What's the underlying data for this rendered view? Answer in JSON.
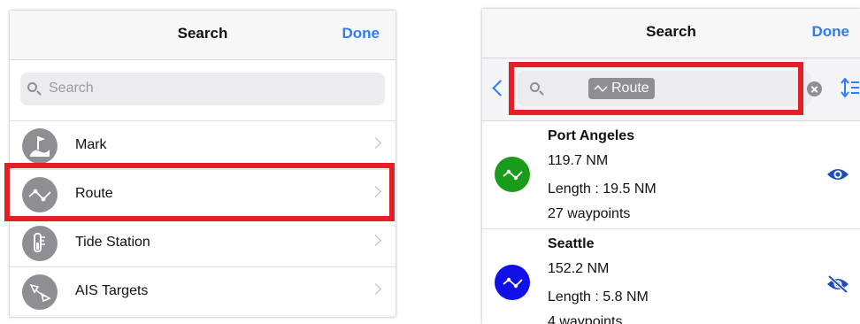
{
  "left_screen": {
    "title": "Search",
    "done_label": "Done",
    "search_placeholder": "Search",
    "categories": [
      {
        "label": "Mark",
        "icon": "mark-flag-icon"
      },
      {
        "label": "Route",
        "icon": "route-icon"
      },
      {
        "label": "Tide Station",
        "icon": "tide-station-icon"
      },
      {
        "label": "AIS Targets",
        "icon": "ais-target-icon"
      }
    ]
  },
  "right_screen": {
    "title": "Search",
    "done_label": "Done",
    "search_token": "Route",
    "results": [
      {
        "name": "Port Angeles",
        "distance": "119.7 NM",
        "length": "Length :  19.5 NM",
        "waypoints": "27 waypoints",
        "icon_color": "#1a9b1a",
        "visibility": "eye-icon"
      },
      {
        "name": "Seattle",
        "distance": "152.2 NM",
        "length": "Length :  5.8 NM",
        "waypoints": "4 waypoints",
        "icon_color": "#1010e8",
        "visibility": "eye-slash-icon"
      }
    ]
  },
  "colors": {
    "accent": "#2f7df6",
    "highlight": "#e41e26",
    "icon_gray": "#8e8e93"
  }
}
